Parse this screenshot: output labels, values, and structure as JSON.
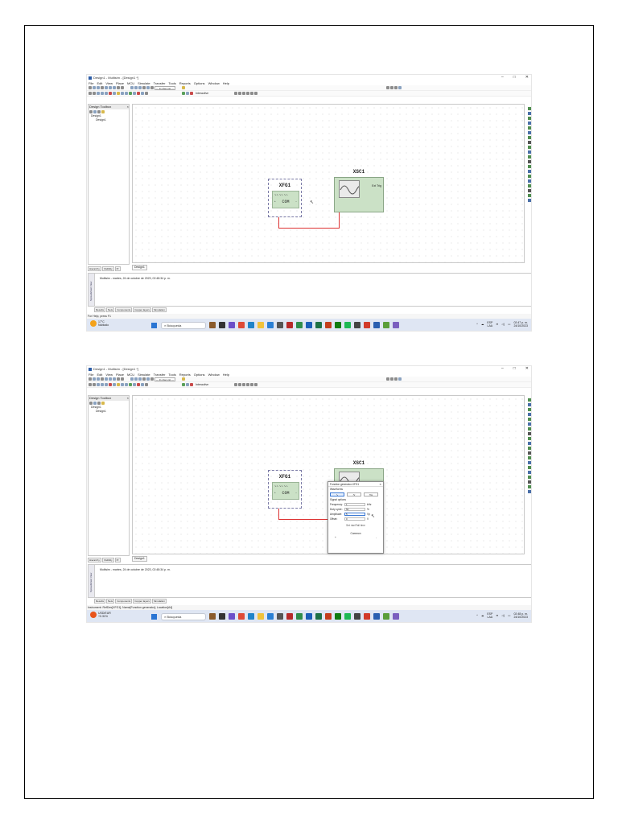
{
  "app": {
    "title": "Design1 - Multisim - [Design1 *]",
    "window_controls": [
      "–",
      "□",
      "✕"
    ],
    "menu": [
      "File",
      "Edit",
      "View",
      "Place",
      "MCU",
      "Simulate",
      "Transfer",
      "Tools",
      "Reports",
      "Options",
      "Window",
      "Help"
    ],
    "in_use_combo": "--- In-Use List ---",
    "interactive_label": "Interactive"
  },
  "toolbox": {
    "title": "Design Toolbox",
    "tree": [
      "Design1",
      "Design1"
    ],
    "tabs": [
      "Hierarchy",
      "Visibility",
      "Pr"
    ]
  },
  "doc_tab": "Design1",
  "components": {
    "xfg_label": "XFG1",
    "xfg_waves": "∿∿ ∿∿ ∿∿",
    "xfg_com": "COM",
    "xsc_label": "XSC1",
    "xsc_ext": "Ext Trig"
  },
  "spreadsheet": {
    "side_label": "Spreadsheet View",
    "message": "Multisim  -  martes, 24 de octubre de 2023, 02:48:34 p. m.",
    "tabs": [
      "Results",
      "Nets",
      "Components",
      "Copper layers",
      "Simulation"
    ]
  },
  "status": {
    "shot1": "For Help, press F1",
    "shot2": "Instrument: RefDes[XFG1]; Name[Function generator]; Location[A4]"
  },
  "taskbar": {
    "shot1_weather_temp": "17°C",
    "shot1_weather_desc": "Nublado",
    "shot2_weather_temp": "USD/EUR",
    "shot2_weather_desc": "+0.31%",
    "search": "Búsqueda",
    "lang": "ESP",
    "lang2": "LAA",
    "shot1_time": "02:47 p. m.",
    "shot2_time": "02:48 p. m.",
    "date": "24/10/2023"
  },
  "dialog": {
    "title": "Function generator-XFG1",
    "waveforms_label": "Waveforms",
    "signal_options_label": "Signal options",
    "rows": [
      {
        "label": "Frequency:",
        "value": "1",
        "unit": "kHz"
      },
      {
        "label": "Duty cycle:",
        "value": "50",
        "unit": "%"
      },
      {
        "label": "Amplitude:",
        "value": "5",
        "unit": "Vp"
      },
      {
        "label": "Offset:",
        "value": "0",
        "unit": "V"
      }
    ],
    "set_rise": "Set rise/Fall time",
    "common_label": "Common",
    "plus": "+",
    "minus": "-"
  }
}
